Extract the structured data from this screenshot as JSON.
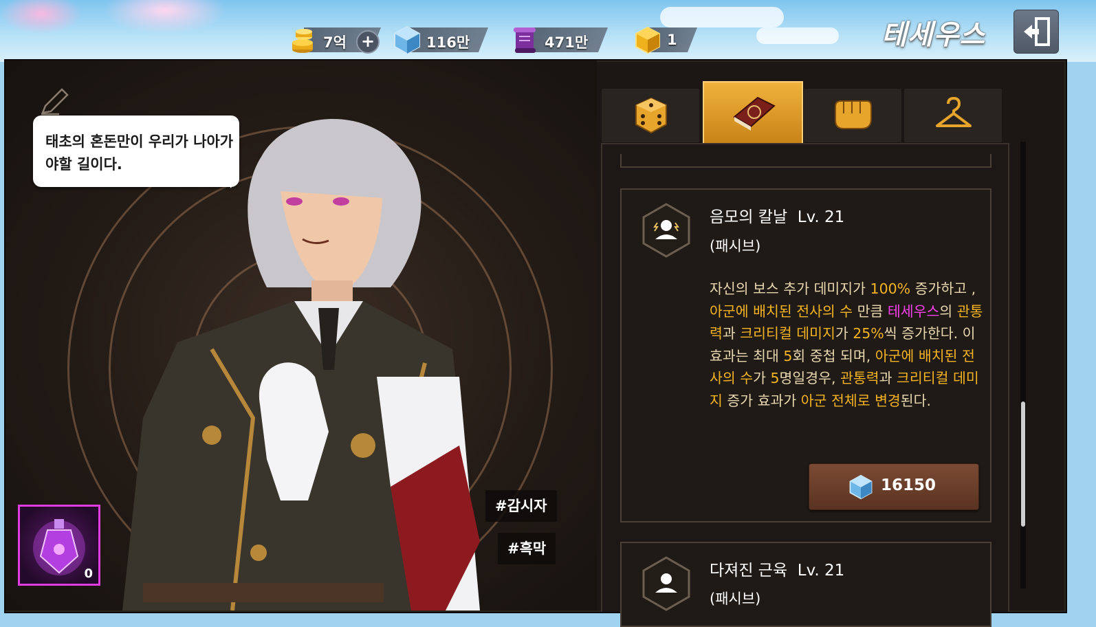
{
  "topbar": {
    "currencies": [
      {
        "name": "gold",
        "value": "7억"
      },
      {
        "name": "crystal",
        "value": "116만"
      },
      {
        "name": "scroll",
        "value": "471만"
      },
      {
        "name": "gold-box",
        "value": "1"
      }
    ],
    "plus_label": "+",
    "hero_name": "테세우스"
  },
  "speech": {
    "text": "태초의 혼돈만이 우리가 나아가야할 길이다."
  },
  "tags": [
    "#감시자",
    "#흑막"
  ],
  "item": {
    "count": "0"
  },
  "tabs": [
    {
      "icon": "dice-icon",
      "active": false
    },
    {
      "icon": "spellbook-icon",
      "active": true
    },
    {
      "icon": "fist-icon",
      "active": false
    },
    {
      "icon": "hanger-icon",
      "active": false
    }
  ],
  "skills": [
    {
      "name": "음모의 칼날",
      "level": "Lv. 21",
      "type": "(패시브)",
      "desc": [
        {
          "t": "자신의 보스 추가 데미지가 ",
          "c": ""
        },
        {
          "t": "100%",
          "c": "y"
        },
        {
          "t": " 증가하고 , ",
          "c": ""
        },
        {
          "t": "아군에 배치된 전사의 수",
          "c": "y"
        },
        {
          "t": " 만큼 ",
          "c": ""
        },
        {
          "t": "테세우스",
          "c": "m"
        },
        {
          "t": "의 ",
          "c": ""
        },
        {
          "t": "관통력",
          "c": "y"
        },
        {
          "t": "과 ",
          "c": ""
        },
        {
          "t": "크리티컬 데미지",
          "c": "y"
        },
        {
          "t": "가 ",
          "c": ""
        },
        {
          "t": "25%",
          "c": "y"
        },
        {
          "t": "씩 증가한다. 이 효과는 최대 ",
          "c": ""
        },
        {
          "t": "5",
          "c": "y"
        },
        {
          "t": "회 중첩 되며, ",
          "c": ""
        },
        {
          "t": "아군에 배치된 전사의 수",
          "c": "y"
        },
        {
          "t": "가 ",
          "c": ""
        },
        {
          "t": "5",
          "c": "y"
        },
        {
          "t": "명일경우, ",
          "c": ""
        },
        {
          "t": "관통력",
          "c": "y"
        },
        {
          "t": "과 ",
          "c": ""
        },
        {
          "t": "크리티컬 데미지",
          "c": "y"
        },
        {
          "t": " 증가 효과가 ",
          "c": ""
        },
        {
          "t": "아군 전체로 변경",
          "c": "y"
        },
        {
          "t": "된다.",
          "c": ""
        }
      ],
      "cost": "16150"
    },
    {
      "name": "다져진 근육",
      "level": "Lv. 21",
      "type": "(패시브)"
    }
  ],
  "colors": {
    "highlight": "#f7b422",
    "hero": "#ff3ff0",
    "tab_active": "#e9a62e"
  }
}
